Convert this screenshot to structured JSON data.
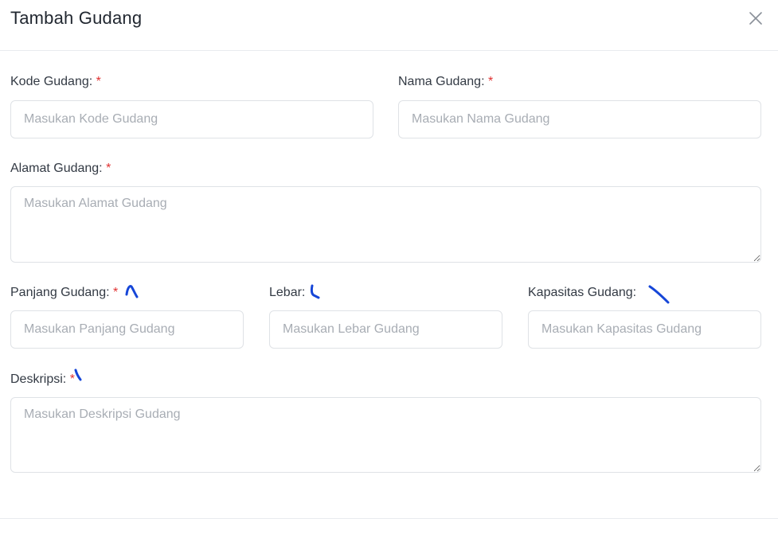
{
  "modal": {
    "title": "Tambah Gudang",
    "close_icon": "close-icon"
  },
  "fields": {
    "kode": {
      "label": "Kode Gudang:",
      "required": "*",
      "placeholder": "Masukan Kode Gudang"
    },
    "nama": {
      "label": "Nama Gudang:",
      "required": "*",
      "placeholder": "Masukan Nama Gudang"
    },
    "alamat": {
      "label": "Alamat Gudang:",
      "required": "*",
      "placeholder": "Masukan Alamat Gudang"
    },
    "panjang": {
      "label": "Panjang Gudang:",
      "required": "*",
      "placeholder": "Masukan Panjang Gudang"
    },
    "lebar": {
      "label": "Lebar:",
      "placeholder": "Masukan Lebar Gudang"
    },
    "kapasitas": {
      "label": "Kapasitas Gudang:",
      "placeholder": "Masukan Kapasitas Gudang"
    },
    "deskripsi": {
      "label": "Deskripsi:",
      "required": "*",
      "placeholder": "Masukan Deskripsi Gudang"
    }
  },
  "colors": {
    "required": "#e03131",
    "annotation_marks": "#1646d8"
  }
}
